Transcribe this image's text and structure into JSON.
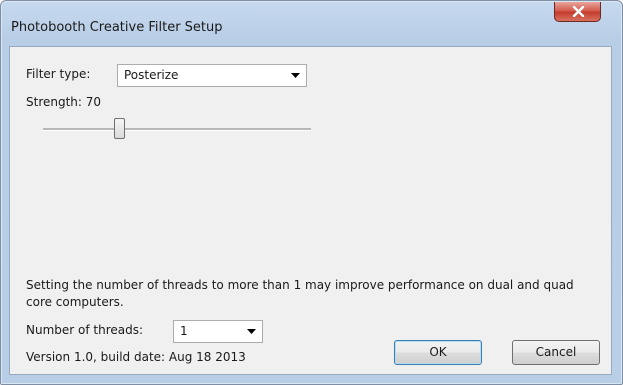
{
  "window": {
    "title": "Photobooth Creative Filter Setup"
  },
  "filter": {
    "label": "Filter type:",
    "selected": "Posterize"
  },
  "strength": {
    "label": "Strength: 70",
    "value": 70,
    "max": 255
  },
  "threads": {
    "info": "Setting the number of threads to more than 1 may improve performance on dual and quad core computers.",
    "label": "Number of threads:",
    "selected": "1"
  },
  "version": "Version 1.0, build date: Aug 18 2013",
  "buttons": {
    "ok": "OK",
    "cancel": "Cancel"
  },
  "colors": {
    "close_button": "#c23a2b",
    "title_bar": "#b9cee7",
    "client_background": "#f0f0f0"
  }
}
